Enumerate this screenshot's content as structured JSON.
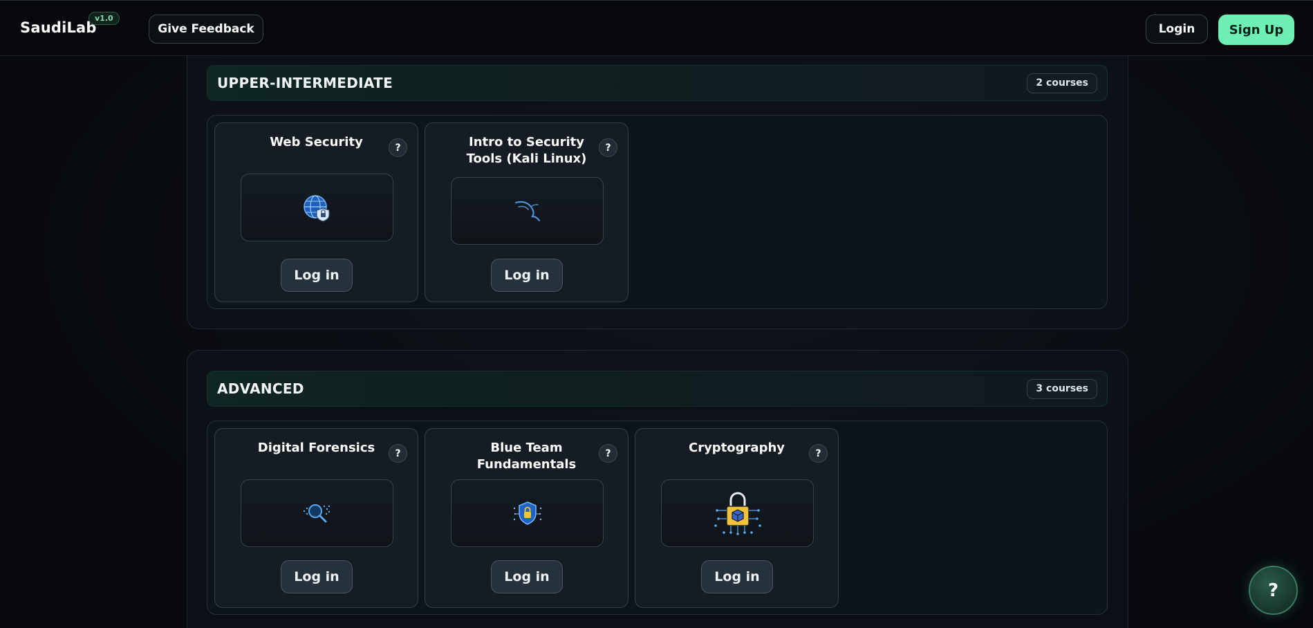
{
  "header": {
    "brand": "SaudiLab",
    "version": "v1.0",
    "feedback_label": "Give Feedback",
    "login_label": "Login",
    "signup_label": "Sign Up"
  },
  "sections": [
    {
      "title": "UPPER-INTERMEDIATE",
      "count_label": "2 courses",
      "courses": [
        {
          "title": "Web Security",
          "icon": "globe-shield-icon",
          "help": "?",
          "action": "Log in"
        },
        {
          "title": "Intro to Security Tools (Kali Linux)",
          "icon": "kali-dragon-icon",
          "help": "?",
          "action": "Log in"
        }
      ]
    },
    {
      "title": "ADVANCED",
      "count_label": "3 courses",
      "courses": [
        {
          "title": "Digital Forensics",
          "icon": "magnifier-data-icon",
          "help": "?",
          "action": "Log in"
        },
        {
          "title": "Blue Team Fundamentals",
          "icon": "shield-lock-icon",
          "help": "?",
          "action": "Log in"
        },
        {
          "title": "Cryptography",
          "icon": "padlock-circuit-icon",
          "help": "?",
          "action": "Log in"
        }
      ]
    }
  ],
  "help_fab": "?",
  "colors": {
    "background": "#0a0d12",
    "accent": "#6ef0b5",
    "card": "#151c24"
  }
}
